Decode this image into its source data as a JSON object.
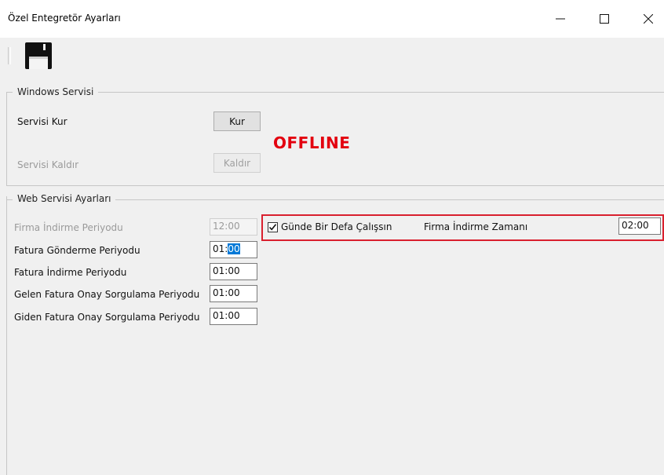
{
  "window": {
    "title": "Özel Entegretör Ayarları",
    "minimize_icon": "minimize-icon",
    "maximize_icon": "maximize-icon",
    "close_icon": "close-icon"
  },
  "toolbar": {
    "save_icon": "floppy-disk-icon"
  },
  "windows_service": {
    "legend": "Windows Servisi",
    "install_label": "Servisi Kur",
    "install_button": "Kur",
    "uninstall_label": "Servisi Kaldır",
    "uninstall_button": "Kaldır",
    "status": "OFFLINE",
    "status_color": "#e3000f"
  },
  "web_service": {
    "legend": "Web Servisi Ayarları",
    "fields": [
      {
        "label": "Firma İndirme Periyodu",
        "value": "12:00",
        "enabled": false
      },
      {
        "label": "Fatura Gönderme Periyodu",
        "value_prefix": "01:",
        "value_selected": "00",
        "enabled": true
      },
      {
        "label": "Fatura İndirme Periyodu",
        "value": "01:00",
        "enabled": true
      },
      {
        "label": "Gelen Fatura Onay Sorgulama Periyodu",
        "value": "01:00",
        "enabled": true
      },
      {
        "label": "Giden Fatura Onay Sorgulama Periyodu",
        "value": "01:00",
        "enabled": true
      }
    ],
    "once_a_day": {
      "checkbox_label": "Günde Bir Defa Çalışsın",
      "checked": true,
      "time_label": "Firma İndirme Zamanı",
      "time_value": "02:00",
      "highlight_color": "#d9202e"
    }
  }
}
